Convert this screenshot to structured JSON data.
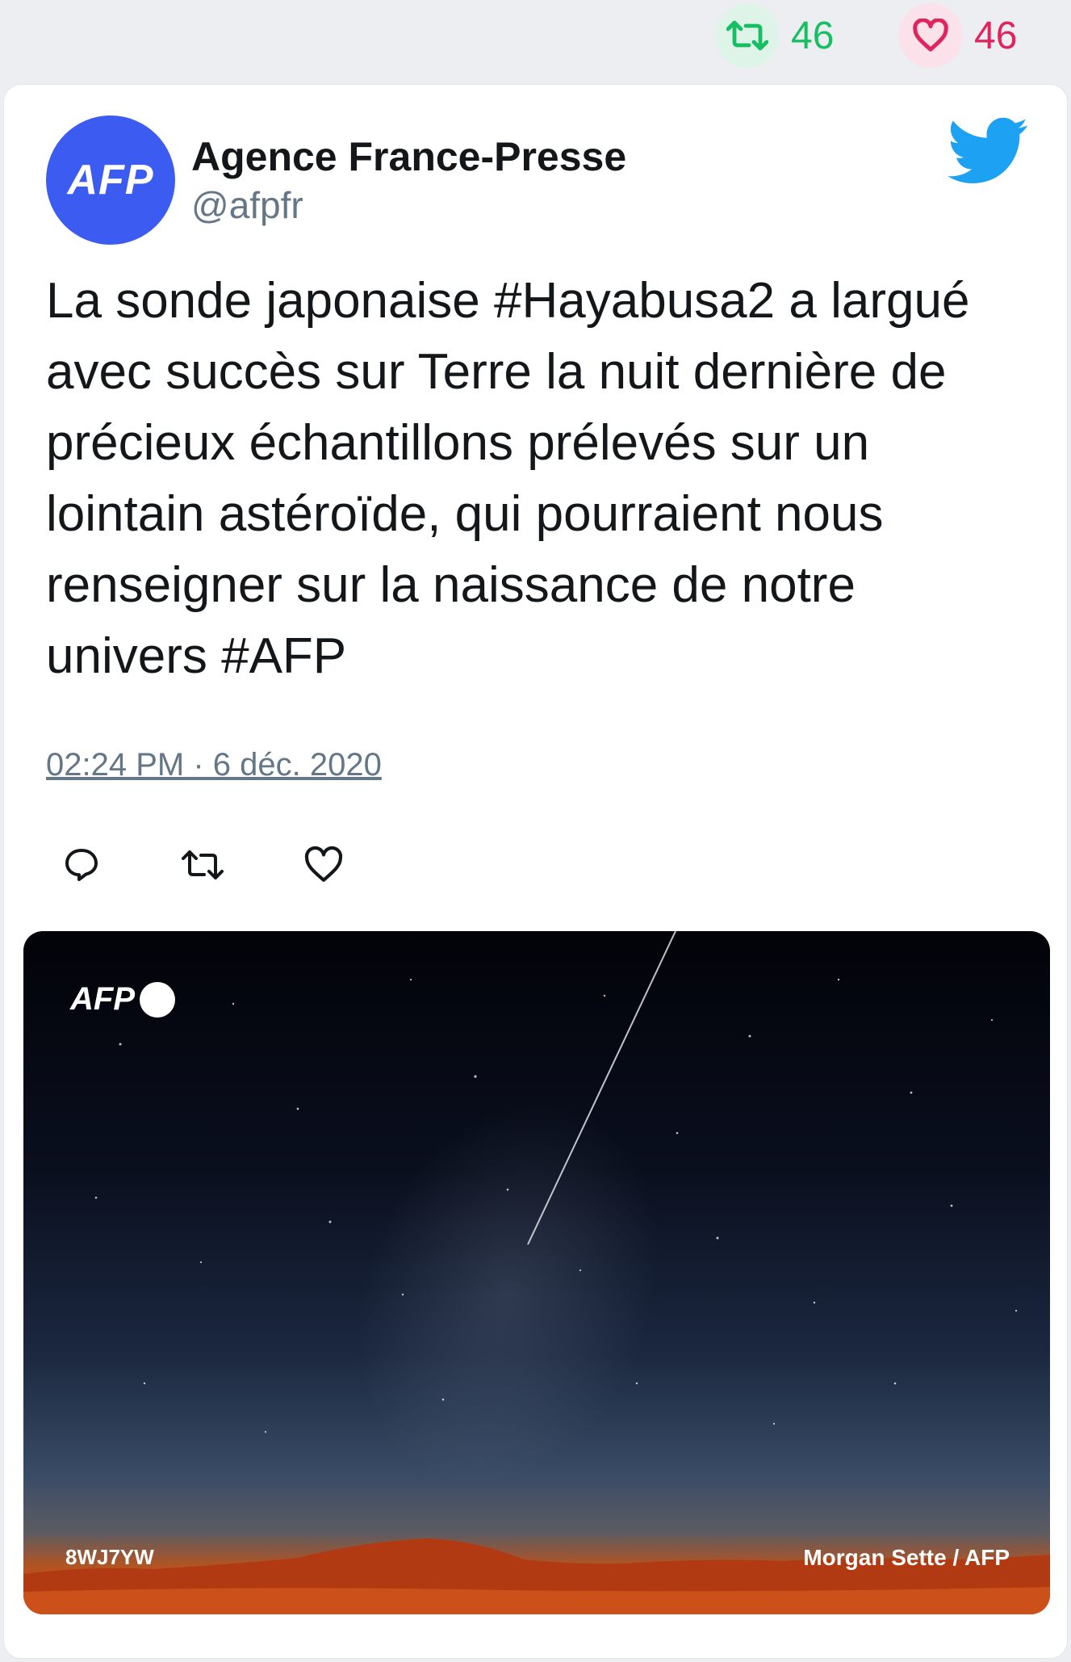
{
  "stats": {
    "retweet_icon": "retweet-icon",
    "retweet_count": "46",
    "like_icon": "heart-icon",
    "like_count": "46"
  },
  "tweet": {
    "avatar_text": "AFP",
    "author_name": "Agence France-Presse",
    "handle": "@afpfr",
    "text": "La sonde japonaise #Hayabusa2 a largué avec succès sur Terre la nuit dernière de précieux échantillons prélevés sur un lointain astéroïde, qui pourraient nous renseigner sur la naissance de notre univers #AFP",
    "timestamp": "02:24 PM · 6 déc. 2020",
    "actions": [
      "reply-icon",
      "retweet-icon",
      "like-icon"
    ]
  },
  "photo": {
    "logo_text": "AFP",
    "code": "8WJ7YW",
    "credit": "Morgan Sette / AFP"
  },
  "colors": {
    "background": "#eceef1",
    "retweet_green": "#17bf63",
    "like_red": "#e0245e",
    "avatar_blue": "#3c5bf0",
    "twitter_blue": "#1da1f2",
    "text_dark": "#14171a",
    "text_muted": "#657786"
  }
}
